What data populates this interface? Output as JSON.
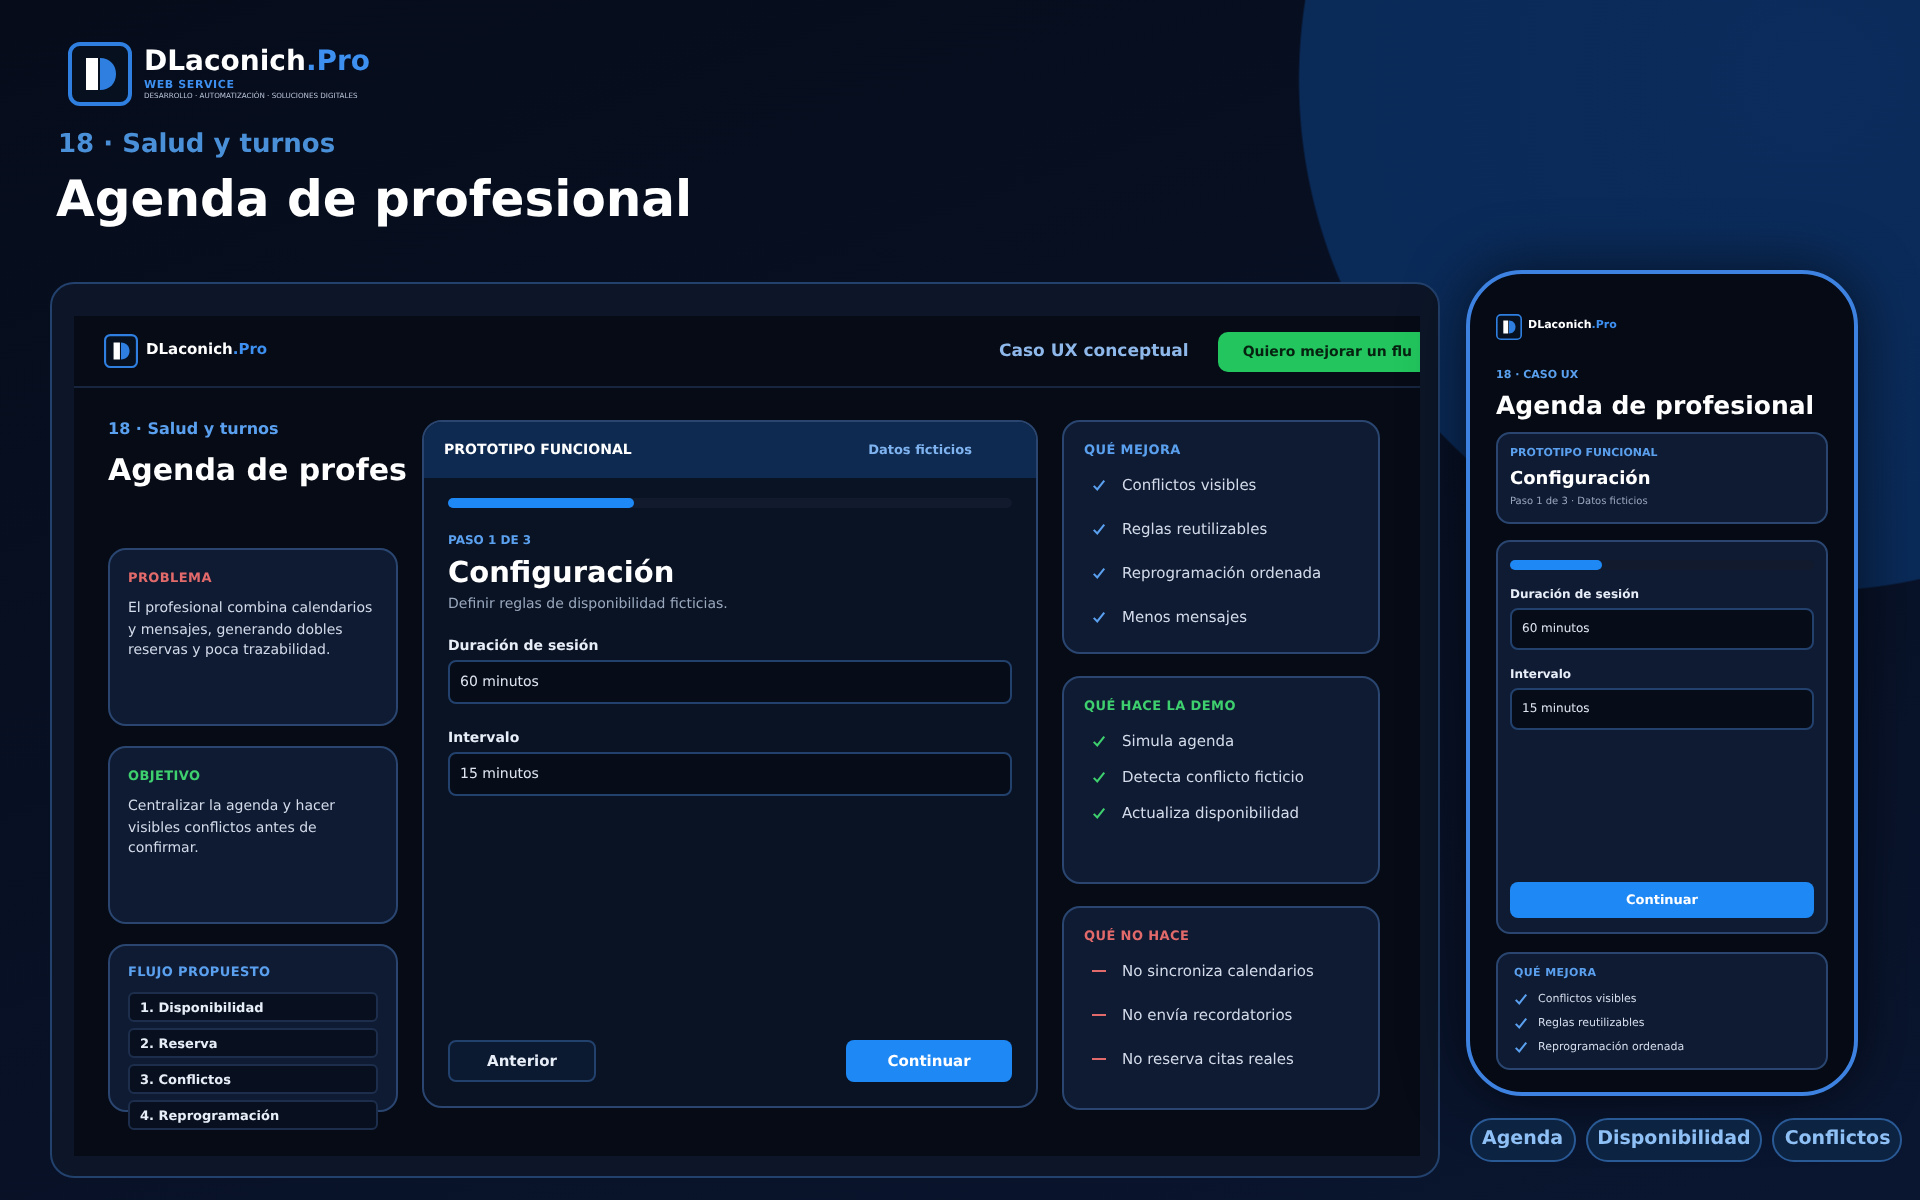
{
  "logo": {
    "name": "DLaconich",
    "suffix": ".Pro",
    "service": "WEB SERVICE",
    "tagline": "DESARROLLO · AUTOMATIZACIÓN · SOLUCIONES DIGITALES"
  },
  "kicker": "18 · Salud y turnos",
  "title": "Agenda de profesional",
  "laptop": {
    "logo": {
      "name": "DLaconich",
      "suffix": ".Pro"
    },
    "nav_link": "Caso UX conceptual",
    "cta": "Quiero mejorar un flu",
    "kicker": "18 · Salud y turnos",
    "title": "Agenda de profes",
    "info_cards": [
      {
        "color": "#e36a6a",
        "label": "PROBLEMA",
        "text": "El profesional combina calendarios y mensajes, generando dobles reservas y poca trazabilidad."
      },
      {
        "color": "#3ecf6e",
        "label": "OBJETIVO",
        "text": "Centralizar la agenda y hacer visibles conflictos antes de confirmar."
      }
    ],
    "flow": {
      "label": "FLUJO PROPUESTO",
      "steps": [
        "1. Disponibilidad",
        "2. Reserva",
        "3. Conflictos",
        "4. Reprogramación"
      ]
    },
    "prototype": {
      "header": "PROTOTIPO FUNCIONAL",
      "badge": "Datos ficticios",
      "progress": {
        "level": 0.33
      },
      "step": "PASO 1 DE 3",
      "heading": "Configuración",
      "description": "Definir reglas de disponibilidad ficticias.",
      "fields": [
        {
          "label": "Duración de sesión",
          "value": "60 minutos"
        },
        {
          "label": "Intervalo",
          "value": "15 minutos"
        }
      ],
      "buttons": [
        {
          "kind": "secondary",
          "label": "Anterior"
        },
        {
          "kind": "primary",
          "label": "Continuar"
        }
      ]
    },
    "lists": [
      {
        "kind": "check",
        "color": "#5aa0ee",
        "title": "QUÉ MEJORA",
        "items": [
          "Conflictos visibles",
          "Reglas reutilizables",
          "Reprogramación ordenada",
          "Menos mensajes"
        ]
      },
      {
        "kind": "check",
        "color": "#3ecf6e",
        "title": "QUÉ HACE LA DEMO",
        "items": [
          "Simula agenda",
          "Detecta conflicto ficticio",
          "Actualiza disponibilidad"
        ]
      },
      {
        "kind": "dash",
        "color": "#e36a6a",
        "title": "QUÉ NO HACE",
        "items": [
          "No sincroniza calendarios",
          "No envía recordatorios",
          "No reserva citas reales"
        ]
      }
    ]
  },
  "phone": {
    "logo": {
      "name": "DLaconich",
      "suffix": ".Pro"
    },
    "kicker": "18 · CASO UX",
    "title": "Agenda de profesional",
    "summary": {
      "header": "PROTOTIPO FUNCIONAL",
      "heading": "Configuración",
      "meta": "Paso 1 de 3 · Datos ficticios"
    },
    "progress": {
      "level": 0.3
    },
    "fields": [
      {
        "label": "Duración de sesión",
        "value": "60 minutos"
      },
      {
        "label": "Intervalo",
        "value": "15 minutos"
      }
    ],
    "button": "Continuar",
    "list": {
      "kind": "check",
      "color": "#5aa0ee",
      "title": "QUÉ MEJORA",
      "items": [
        "Conflictos visibles",
        "Reglas reutilizables",
        "Reprogramación ordenada"
      ]
    }
  },
  "chips": [
    "Agenda",
    "Disponibilidad",
    "Conflictos"
  ]
}
